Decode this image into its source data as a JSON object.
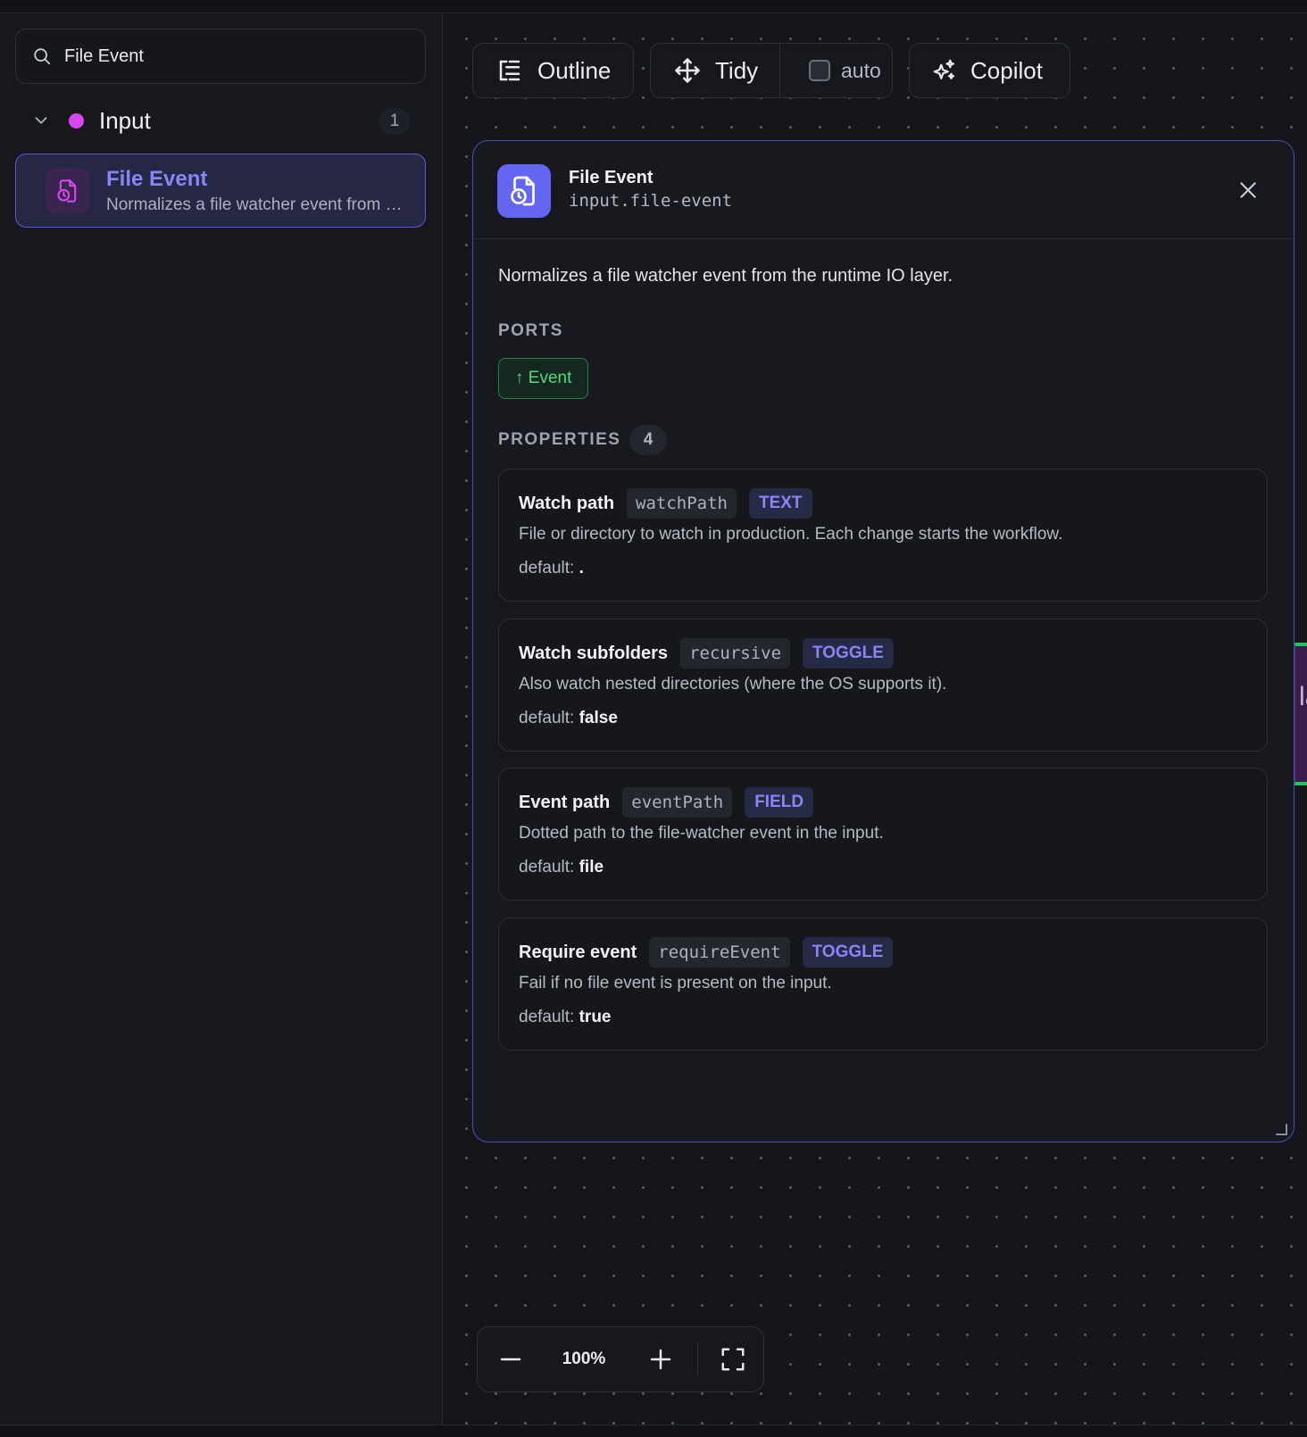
{
  "search": {
    "value": "File Event"
  },
  "palette": {
    "group": {
      "label": "Input",
      "count": "1",
      "dot_color": "#d946ef"
    },
    "items": [
      {
        "title": "File Event",
        "description": "Normalizes a file watcher event from the runtime IO layer."
      }
    ]
  },
  "toolbar": {
    "outline_label": "Outline",
    "tidy_label": "Tidy",
    "auto_label": "auto",
    "copilot_label": "Copilot"
  },
  "canvas_node_fragment": "la",
  "panel": {
    "title": "File Event",
    "type_id": "input.file-event",
    "description": "Normalizes a file watcher event from the runtime IO layer.",
    "ports_label": "PORTS",
    "ports": [
      {
        "label": "↑ Event"
      }
    ],
    "properties_label": "PROPERTIES",
    "properties_count": "4",
    "properties": [
      {
        "name": "Watch path",
        "key": "watchPath",
        "type": "TEXT",
        "description": "File or directory to watch in production. Each change starts the workflow.",
        "default_label": "default:",
        "default_value": "."
      },
      {
        "name": "Watch subfolders",
        "key": "recursive",
        "type": "TOGGLE",
        "description": "Also watch nested directories (where the OS supports it).",
        "default_label": "default:",
        "default_value": "false"
      },
      {
        "name": "Event path",
        "key": "eventPath",
        "type": "FIELD",
        "description": "Dotted path to the file-watcher event in the input.",
        "default_label": "default:",
        "default_value": "file"
      },
      {
        "name": "Require event",
        "key": "requireEvent",
        "type": "TOGGLE",
        "description": "Fail if no file event is present on the input.",
        "default_label": "default:",
        "default_value": "true"
      }
    ]
  },
  "zoom": {
    "value": "100%"
  },
  "colors": {
    "accent": "#6366f1",
    "accent_text": "#8b84f7",
    "port_green": "#4ade80",
    "panel_border": "#4a4fb8"
  }
}
